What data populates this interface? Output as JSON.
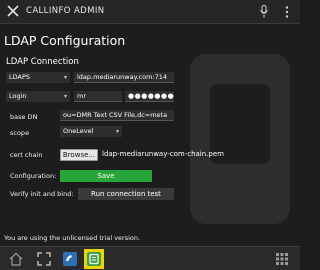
{
  "titlebar": {
    "title": "CALLINFO ADMIN",
    "close_icon": "close-icon",
    "mic_icon": "microphone-icon",
    "more_icon": "more-vertical-icon"
  },
  "page": {
    "heading": "LDAP Configuration",
    "section": "LDAP Connection"
  },
  "form": {
    "protocol": "LDAPS",
    "host": "ldap.mediarunway.com:714",
    "auth_method": "Login",
    "username": "mr",
    "password_mask": "●●●●●●●●●●●●●",
    "base_dn_label": "base DN",
    "base_dn": "ou=DMR Text CSV File,dc=meta",
    "scope_label": "scope",
    "scope": "OneLevel",
    "cert_label": "cert chain",
    "browse_label": "Browse...",
    "cert_file": "ldap-mediarunway-com-chain.pem",
    "config_label": "Configuration:",
    "save_label": "Save",
    "verify_label": "Verify init and bind:",
    "run_label": "Run connection test"
  },
  "status": {
    "trial_text": "You are using the unlicensed trial version."
  },
  "colors": {
    "accent": "#27a53a",
    "active_tab": "#f0d200",
    "background": "#1c1c1c"
  },
  "taskbar": {
    "icons": [
      "home-icon",
      "fullscreen-icon",
      "callinfo-app-icon",
      "callinfo-admin-app-icon",
      "grid-icon"
    ]
  }
}
